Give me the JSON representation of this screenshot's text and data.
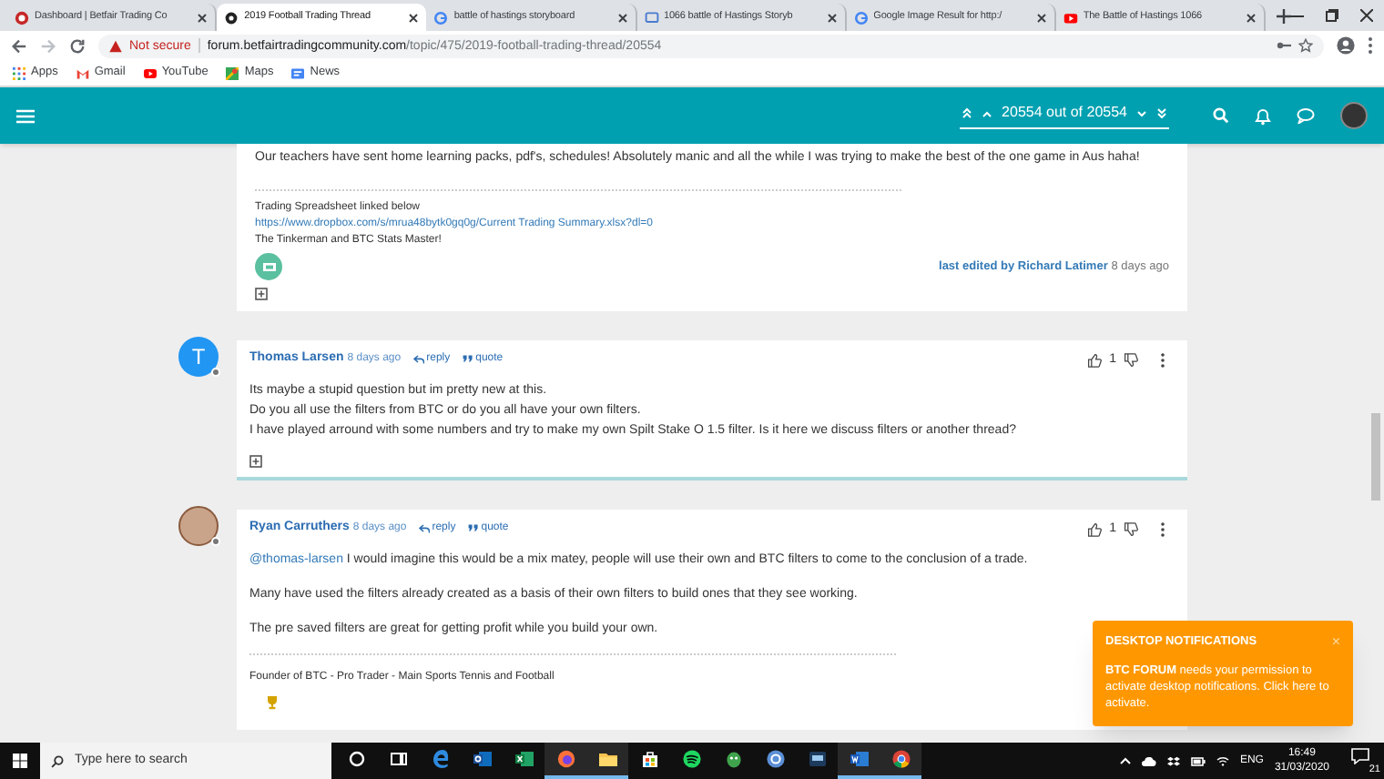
{
  "browser": {
    "tabs": [
      {
        "title": "Dashboard | Betfair Trading Co",
        "selected": false
      },
      {
        "title": "2019 Football Trading Thread",
        "selected": true
      },
      {
        "title": "battle of hastings storyboard",
        "selected": false
      },
      {
        "title": "1066 battle of Hastings Storyb",
        "selected": false
      },
      {
        "title": "Google Image Result for http:/",
        "selected": false
      },
      {
        "title": "The Battle of Hastings 1066",
        "selected": false
      }
    ],
    "security": "Not secure",
    "url_host": "forum.betfairtradingcommunity.com",
    "url_path": "/topic/475/2019-football-trading-thread/20554",
    "bookmarks": [
      {
        "label": "Apps"
      },
      {
        "label": "Gmail"
      },
      {
        "label": "YouTube"
      },
      {
        "label": "Maps"
      },
      {
        "label": "News"
      }
    ]
  },
  "header": {
    "pagination": "20554 out of 20554"
  },
  "posts": [
    {
      "kind": "continued",
      "lead": "Our teachers have sent home learning packs, pdf's, schedules! Absolutely manic and all the while I was trying to make the best of the one game in Aus haha!",
      "signature": [
        "Trading Spreadsheet linked below"
      ],
      "signature_link": "https://www.dropbox.com/s/mrua48bytk0gq0g/Current Trading Summary.xlsx?dl=0",
      "signature_after": [
        "The Tinkerman and BTC Stats Master!"
      ],
      "edited_label": "last edited by",
      "edited_by": "Richard Latimer",
      "edited_time": "8 days ago"
    },
    {
      "kind": "full",
      "avatar_letter": "T",
      "author": "Thomas Larsen",
      "time": "8 days ago",
      "reply": "reply",
      "quote": "quote",
      "votes": "1",
      "online": false,
      "paragraphs": [
        {
          "lines": [
            "Its maybe a stupid question but im pretty new at this.",
            "Do you all use the filters from BTC or do you all have your own filters.",
            "I have played arround with some numbers and try to make my own Spilt Stake O 1.5 filter. Is it here we discuss filters or another thread?"
          ]
        }
      ]
    },
    {
      "kind": "full",
      "author": "Ryan Carruthers",
      "time": "8 days ago",
      "reply": "reply",
      "quote": "quote",
      "votes": "1",
      "online": false,
      "paragraphs": [
        {
          "mention": "@thomas-larsen",
          "lines": [
            "I would imagine this would be a mix matey, people will use their own and BTC filters to come to the conclusion of a trade."
          ]
        },
        {
          "lines": [
            "Many have used the filters already created as a basis of their own filters to build ones that they see working."
          ]
        },
        {
          "lines": [
            "The pre saved filters are great for getting profit while you build your own."
          ]
        }
      ],
      "signature": [
        "Founder of BTC - Pro Trader - Main Sports Tennis and Football"
      ]
    }
  ],
  "notification": {
    "title": "DESKTOP NOTIFICATIONS",
    "close": "×",
    "body": "**BTC FORUM** needs your permission to activate desktop notifications. Click here to activate."
  },
  "taskbar": {
    "search_placeholder": "Type here to search",
    "apps": [
      {
        "active": false
      },
      {
        "active": false
      },
      {
        "active": false
      },
      {
        "active": false
      },
      {
        "active": false
      },
      {
        "active": true
      },
      {
        "active": true
      },
      {
        "active": false
      },
      {
        "active": false
      },
      {
        "active": false
      },
      {
        "active": false
      },
      {
        "active": false
      },
      {
        "active": true
      },
      {
        "active": true
      }
    ],
    "language": "ENG",
    "time": "16:49",
    "date": "31/03/2020",
    "notifications": "21"
  }
}
